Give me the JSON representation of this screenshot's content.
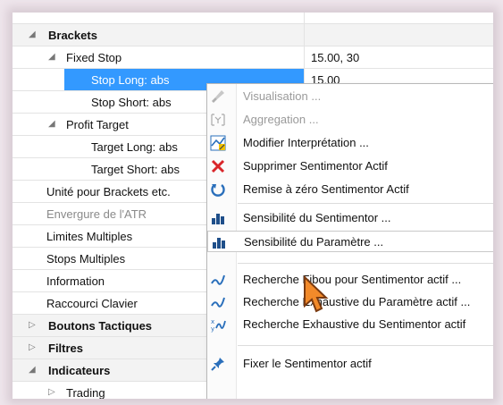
{
  "tree": {
    "rows": [
      {
        "label": "Brackets",
        "value": "",
        "expander": "◢",
        "bold": true
      },
      {
        "label": "Fixed Stop",
        "value": "15.00, 30",
        "expander": "◢"
      },
      {
        "label": "Stop Long: abs",
        "value": "15.00",
        "selected": true
      },
      {
        "label": "Stop Short: abs",
        "value": ""
      },
      {
        "label": "Profit Target",
        "value": "",
        "expander": "◢"
      },
      {
        "label": "Target Long: abs",
        "value": ""
      },
      {
        "label": "Target Short: abs",
        "value": ""
      },
      {
        "label": "Unité pour Brackets etc.",
        "value": ""
      },
      {
        "label": "Envergure de l'ATR",
        "value": "",
        "disabled": true
      },
      {
        "label": "Limites Multiples",
        "value": ""
      },
      {
        "label": "Stops Multiples",
        "value": ""
      },
      {
        "label": "Information",
        "value": ""
      },
      {
        "label": "Raccourci Clavier",
        "value": ""
      },
      {
        "label": "Boutons Tactiques",
        "value": "",
        "expander": "▷",
        "bold": true
      },
      {
        "label": "Filtres",
        "value": "",
        "expander": "▷",
        "bold": true
      },
      {
        "label": "Indicateurs",
        "value": "",
        "expander": "◢",
        "bold": true
      },
      {
        "label": "Trading",
        "value": "",
        "expander": "▷"
      }
    ]
  },
  "context_menu": {
    "items": [
      {
        "label": "Visualisation ...",
        "icon": "brush-icon",
        "disabled": true
      },
      {
        "label": "Aggregation ...",
        "icon": "aggregation-icon",
        "disabled": true
      },
      {
        "label": "Modifier Interprétation ...",
        "icon": "interpretation-icon"
      },
      {
        "label": "Supprimer Sentimentor Actif",
        "icon": "delete-icon"
      },
      {
        "label": "Remise à zéro Sentimentor Actif",
        "icon": "reset-icon"
      },
      {
        "label": "Sensibilité du Sentimentor ...",
        "icon": "bar-chart-icon"
      },
      {
        "label": "Sensibilité du Paramètre ...",
        "icon": "bar-chart-icon"
      },
      {
        "label": "Recherche Fibou pour Sentimentor actif ...",
        "icon": "check-curve-icon"
      },
      {
        "label": "Recherche Exhaustive du Paramètre actif ...",
        "icon": "check-curve-icon"
      },
      {
        "label": "Recherche Exhaustive du Sentimentor actif",
        "icon": "xy-curve-icon"
      },
      {
        "label": "Fixer le Sentimentor actif",
        "icon": "pin-icon"
      }
    ]
  },
  "colors": {
    "selection": "#3399ff",
    "delete_red": "#d9262a",
    "icon_blue": "#2a6fbb",
    "cursor_orange": "#e46a1a"
  }
}
